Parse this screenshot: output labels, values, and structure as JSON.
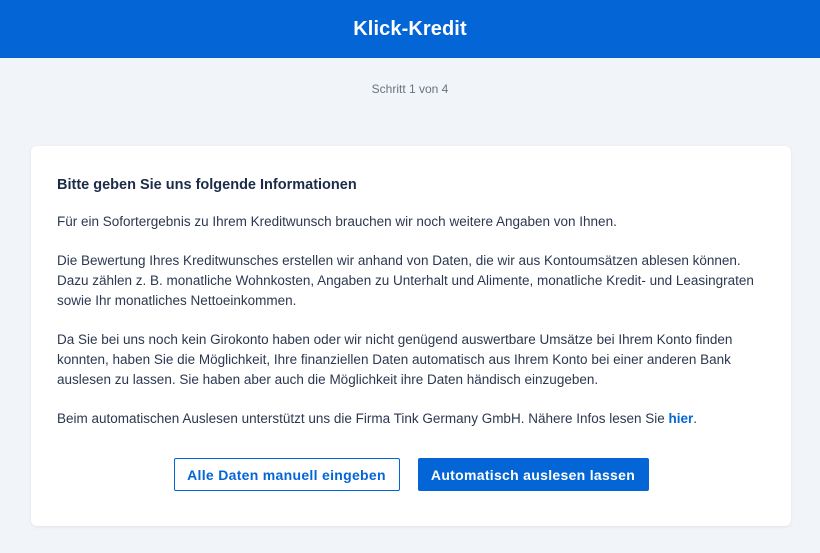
{
  "header": {
    "title": "Klick-Kredit"
  },
  "progress": {
    "step_text": "Schritt 1 von 4"
  },
  "card": {
    "heading": "Bitte geben Sie uns folgende Informationen",
    "paragraph_1": "Für ein Sofortergebnis zu Ihrem Kreditwunsch brauchen wir noch weitere Angaben von Ihnen.",
    "paragraph_2": "Die Bewertung Ihres Kreditwunsches erstellen wir anhand von Daten, die wir aus Kontoumsätzen ablesen können. Dazu zählen z. B. monatliche Wohnkosten, Angaben zu Unterhalt und Alimente, monatliche Kredit- und Leasingraten sowie Ihr monatliches Nettoeinkommen.",
    "paragraph_3": "Da Sie bei uns noch kein Girokonto haben oder wir nicht genügend auswertbare Umsätze bei Ihrem Konto finden konnten, haben Sie die Möglichkeit, Ihre finanziellen Daten automatisch aus Ihrem Konto bei einer anderen Bank auslesen zu lassen. Sie haben aber auch die Möglichkeit ihre Daten händisch einzugeben.",
    "paragraph_4_text": "Beim automatischen Auslesen unterstützt uns die Firma Tink Germany GmbH. Nähere Infos lesen Sie ",
    "paragraph_4_link": "hier",
    "paragraph_4_end": "."
  },
  "actions": {
    "manual_label": "Alle Daten manuell eingeben",
    "auto_label": "Automatisch auslesen lassen"
  },
  "colors": {
    "brand_blue": "#0466d6",
    "page_background": "#f1f4f8",
    "card_background": "#ffffff"
  }
}
